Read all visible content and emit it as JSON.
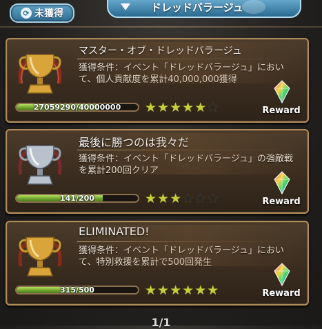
{
  "header": {
    "filter_label": "未獲得",
    "dropdown_label": "ドレッドバラージュ"
  },
  "achievements": [
    {
      "title": "マスター・オブ・ドレッドバラージュ",
      "description": "獲得条件：イベント「ドレッドバラージュ」において、個人貢献度を累計40,000,000獲得",
      "progress_text": "27059290/40000000",
      "progress_fraction": 0.68,
      "stars_filled": 5,
      "stars_total": 6,
      "trophy": "gold-cup",
      "reward_label": "Reward"
    },
    {
      "title": "最後に勝つのは我々だ",
      "description": "獲得条件：イベント「ドレッドバラージュ」の強敵戦を累計200回クリア",
      "progress_text": "141/200",
      "progress_fraction": 0.71,
      "stars_filled": 3,
      "stars_total": 6,
      "trophy": "silver-cup",
      "reward_label": "Reward"
    },
    {
      "title": "ELIMINATED!",
      "description": "獲得条件：イベント「ドレッドバラージュ」において、特別救援を累計で500回発生",
      "progress_text": "315/500",
      "progress_fraction": 0.63,
      "stars_filled": 6,
      "stars_total": 6,
      "trophy": "gold-cup",
      "reward_label": "Reward"
    }
  ],
  "pager": {
    "label": "1/1"
  },
  "colors": {
    "gold": "#d9a43a",
    "silver": "#b9c2cc",
    "progress": "#8cc43a",
    "star_on": "#c6cf3a"
  }
}
